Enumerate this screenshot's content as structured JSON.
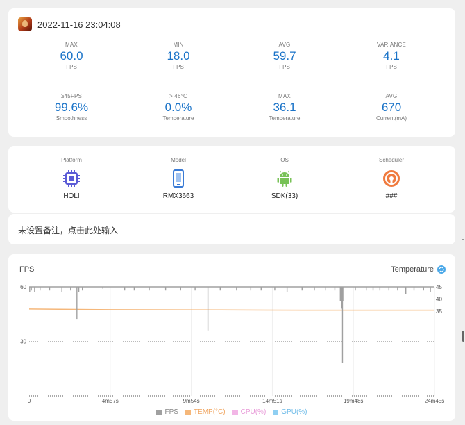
{
  "header": {
    "datetime": "2022-11-16 23:04:08",
    "app_icon": "game-app-icon"
  },
  "stats": [
    {
      "label": "MAX",
      "value": "60.0",
      "unit": "FPS"
    },
    {
      "label": "MIN",
      "value": "18.0",
      "unit": "FPS"
    },
    {
      "label": "AVG",
      "value": "59.7",
      "unit": "FPS"
    },
    {
      "label": "VARIANCE",
      "value": "4.1",
      "unit": "FPS"
    },
    {
      "label": "≥45FPS",
      "value": "99.6%",
      "unit": "Smoothness"
    },
    {
      "label": "> 46°C",
      "value": "0.0%",
      "unit": "Temperature"
    },
    {
      "label": "MAX",
      "value": "36.1",
      "unit": "Temperature"
    },
    {
      "label": "AVG",
      "value": "670",
      "unit": "Current(mA)"
    }
  ],
  "device": [
    {
      "label": "Platform",
      "value": "HOLI",
      "icon": "chip-icon"
    },
    {
      "label": "Model",
      "value": "RMX3663",
      "icon": "phone-icon"
    },
    {
      "label": "OS",
      "value": "SDK(33)",
      "icon": "android-icon"
    },
    {
      "label": "Scheduler",
      "value": "###",
      "icon": "scheduler-icon"
    }
  ],
  "note": {
    "text": "未设置备注，点击此处输入"
  },
  "chart": {
    "title": "FPS",
    "right_label": "Temperature",
    "legend": [
      {
        "name": "FPS",
        "color": "#a0a0a0"
      },
      {
        "name": "TEMP(°C)",
        "color": "#f5b77a"
      },
      {
        "name": "CPU(%)",
        "color": "#f2b6e6"
      },
      {
        "name": "GPU(%)",
        "color": "#8fcff2"
      }
    ]
  },
  "chart_data": {
    "type": "line",
    "title": "",
    "x_ticks": [
      "0",
      "4m57s",
      "9m54s",
      "14m51s",
      "19m48s",
      "24m45s"
    ],
    "x_range_seconds": [
      0,
      1485
    ],
    "y_left_ticks": [
      "60",
      "30"
    ],
    "y_left_range": [
      0,
      60
    ],
    "y_right_ticks": [
      "45",
      "40",
      "35"
    ],
    "y_right_range": [
      0,
      45
    ],
    "series": [
      {
        "name": "FPS",
        "color": "#a0a0a0",
        "baseline": 60,
        "dips": [
          {
            "t": 2,
            "v": 57
          },
          {
            "t": 8,
            "v": 58
          },
          {
            "t": 20,
            "v": 57
          },
          {
            "t": 40,
            "v": 58
          },
          {
            "t": 75,
            "v": 58
          },
          {
            "t": 120,
            "v": 57
          },
          {
            "t": 152,
            "v": 58
          },
          {
            "t": 175,
            "v": 42
          },
          {
            "t": 182,
            "v": 57
          },
          {
            "t": 195,
            "v": 58
          },
          {
            "t": 270,
            "v": 59
          },
          {
            "t": 350,
            "v": 58
          },
          {
            "t": 385,
            "v": 58
          },
          {
            "t": 440,
            "v": 58
          },
          {
            "t": 500,
            "v": 58
          },
          {
            "t": 555,
            "v": 58
          },
          {
            "t": 608,
            "v": 58
          },
          {
            "t": 655,
            "v": 36
          },
          {
            "t": 700,
            "v": 58
          },
          {
            "t": 760,
            "v": 58
          },
          {
            "t": 812,
            "v": 58
          },
          {
            "t": 850,
            "v": 58
          },
          {
            "t": 900,
            "v": 58
          },
          {
            "t": 945,
            "v": 57
          },
          {
            "t": 1000,
            "v": 58
          },
          {
            "t": 1045,
            "v": 58
          },
          {
            "t": 1085,
            "v": 58
          },
          {
            "t": 1120,
            "v": 58
          },
          {
            "t": 1140,
            "v": 52
          },
          {
            "t": 1145,
            "v": 48
          },
          {
            "t": 1148,
            "v": 18
          },
          {
            "t": 1152,
            "v": 52
          },
          {
            "t": 1195,
            "v": 58
          },
          {
            "t": 1235,
            "v": 58
          },
          {
            "t": 1260,
            "v": 58
          },
          {
            "t": 1285,
            "v": 58
          },
          {
            "t": 1318,
            "v": 58
          },
          {
            "t": 1350,
            "v": 58
          },
          {
            "t": 1380,
            "v": 56
          },
          {
            "t": 1410,
            "v": 58
          },
          {
            "t": 1445,
            "v": 58
          },
          {
            "t": 1470,
            "v": 57
          }
        ]
      },
      {
        "name": "TEMP(°C)",
        "color": "#f5b77a",
        "points": [
          [
            0,
            35.9
          ],
          [
            300,
            35.6
          ],
          [
            700,
            35.5
          ],
          [
            1000,
            35.4
          ],
          [
            1485,
            35.4
          ]
        ]
      }
    ],
    "grid": true
  }
}
